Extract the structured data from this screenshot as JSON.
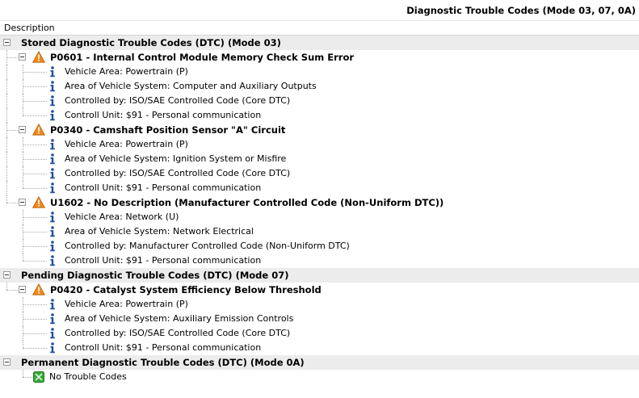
{
  "window": {
    "title": "Diagnostic Trouble Codes (Mode 03, 07, 0A)"
  },
  "columns": {
    "description": "Description"
  },
  "sections": [
    {
      "title": "Stored Diagnostic Trouble Codes (DTC) (Mode 03)",
      "codes": [
        {
          "title": "P0601 - Internal Control Module Memory Check Sum Error",
          "details": [
            "Vehicle Area: Powertrain (P)",
            "Area of Vehicle System: Computer and Auxiliary Outputs",
            "Controlled by: ISO/SAE Controlled Code (Core DTC)",
            "Controll Unit: $91 - Personal communication"
          ]
        },
        {
          "title": "P0340 - Camshaft Position Sensor \"A\" Circuit",
          "details": [
            "Vehicle Area: Powertrain (P)",
            "Area of Vehicle System: Ignition System or Misfire",
            "Controlled by: ISO/SAE Controlled Code (Core DTC)",
            "Controll Unit: $91 - Personal communication"
          ]
        },
        {
          "title": "U1602 - No Description (Manufacturer Controlled Code (Non-Uniform DTC))",
          "details": [
            "Vehicle Area: Network (U)",
            "Area of Vehicle System: Network Electrical",
            "Controlled by: Manufacturer Controlled Code (Non-Uniform DTC)",
            "Controll Unit: $91 - Personal communication"
          ]
        }
      ]
    },
    {
      "title": "Pending Diagnostic Trouble Codes (DTC) (Mode 07)",
      "codes": [
        {
          "title": "P0420 - Catalyst System Efficiency Below Threshold",
          "details": [
            "Vehicle Area: Powertrain (P)",
            "Area of Vehicle System: Auxiliary Emission Controls",
            "Controlled by: ISO/SAE Controlled Code (Core DTC)",
            "Controll Unit: $91 - Personal communication"
          ]
        }
      ]
    },
    {
      "title": "Permanent Diagnostic Trouble Codes (DTC) (Mode 0A)",
      "codes": [],
      "empty": "No Trouble Codes"
    }
  ],
  "icons": {
    "expander": "collapse-minus-icon",
    "code": "warning-triangle-icon",
    "detail": "info-icon",
    "empty": "ok-check-icon"
  },
  "colors": {
    "section_bg": "#ececec",
    "warning": "#f08a1c",
    "info": "#1f4fa0",
    "ok": "#3aa53a"
  }
}
